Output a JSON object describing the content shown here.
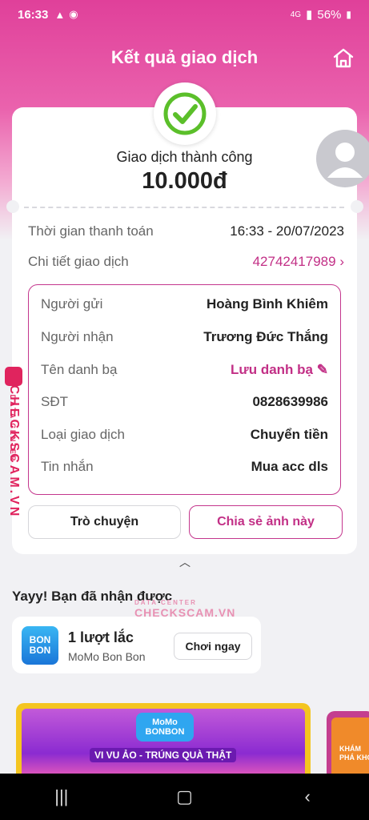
{
  "status_bar": {
    "time": "16:33",
    "icons_left": [
      "warning-icon",
      "messenger-icon"
    ],
    "network": "4G",
    "battery": "56%"
  },
  "header": {
    "title": "Kết quả giao dịch",
    "home_icon": "home-icon"
  },
  "result": {
    "status_text": "Giao dịch thành công",
    "amount": "10.000đ"
  },
  "info": {
    "time_label": "Thời gian thanh toán",
    "time_value": "16:33 - 20/07/2023",
    "detail_label": "Chi tiết giao dịch",
    "detail_value": "42742417989"
  },
  "details": {
    "sender_label": "Người gửi",
    "sender_value": "Hoàng Bình Khiêm",
    "receiver_label": "Người nhận",
    "receiver_value": "Trương Đức Thắng",
    "contact_label": "Tên danh bạ",
    "contact_value": "Lưu danh bạ",
    "phone_label": "SĐT",
    "phone_value": "0828639986",
    "type_label": "Loại giao dịch",
    "type_value": "Chuyển tiền",
    "message_label": "Tin nhắn",
    "message_value": "Mua acc dls"
  },
  "actions": {
    "chat": "Trò chuyện",
    "share": "Chia sẻ ảnh này"
  },
  "reward_section": {
    "title": "Yayy! Bạn đã nhận được",
    "item_title": "1 lượt lắc",
    "item_subtitle": "MoMo Bon Bon",
    "play_button": "Chơi ngay",
    "logo_line1": "BON",
    "logo_line2": "BON"
  },
  "banner": {
    "logo_text": "MoMo BONBON",
    "tagline": "VI VU ẢO - TRÚNG QUÀ THẬT",
    "side_text": "KHÁM PHÁ KHO"
  },
  "watermark": {
    "brand": "CHECKSCAM.VN",
    "sub": "DATA CENTER"
  },
  "colors": {
    "brand_pink": "#c22f86",
    "header_gradient_top": "#e0409a",
    "success_green": "#5bbf2a"
  }
}
